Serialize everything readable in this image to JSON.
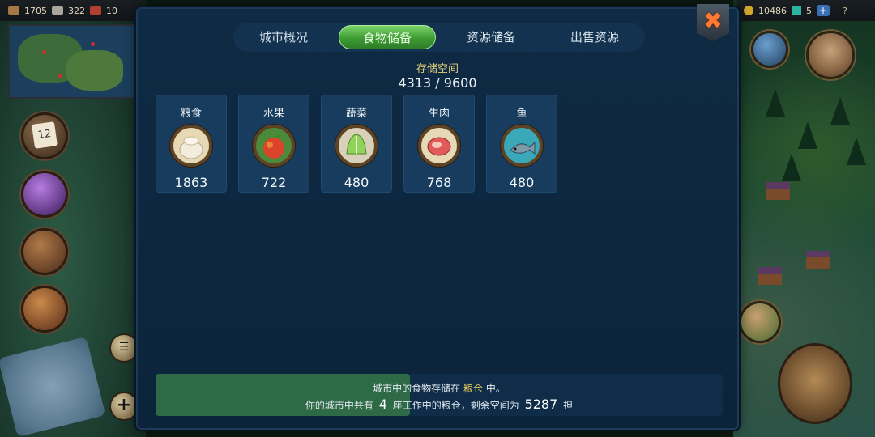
{
  "top_bar_left": {
    "res1": "1705",
    "res2": "322",
    "res3": "10"
  },
  "top_bar_right": {
    "gold": "10486",
    "gems": "5",
    "plus": "+",
    "help": "?"
  },
  "calendar_day": "12",
  "plus_button": "+",
  "tabs": [
    {
      "label": "城市概况",
      "active": false
    },
    {
      "label": "食物储备",
      "active": true
    },
    {
      "label": "资源储备",
      "active": false
    },
    {
      "label": "出售资源",
      "active": false
    }
  ],
  "close_label": "✖",
  "storage": {
    "label": "存储空间",
    "used": 4313,
    "capacity": 9600,
    "display": "4313 / 9600"
  },
  "foods": [
    {
      "name": "粮食",
      "value": "1863",
      "icon": "grain-sack-icon"
    },
    {
      "name": "水果",
      "value": "722",
      "icon": "apple-icon"
    },
    {
      "name": "蔬菜",
      "value": "480",
      "icon": "cabbage-icon"
    },
    {
      "name": "生肉",
      "value": "768",
      "icon": "meat-icon"
    },
    {
      "name": "鱼",
      "value": "480",
      "icon": "fish-icon"
    }
  ],
  "info": {
    "line1_prefix": "城市中的食物存储在",
    "line1_building": "粮仓",
    "line1_suffix": "中。",
    "line2_prefix": "你的城市中共有",
    "granary_count": "4",
    "line2_middle": "座工作中的粮仓，剩余空间为",
    "remaining": "5287",
    "line2_unit": "担",
    "fill_fraction": 0.449
  },
  "colors": {
    "accent_green": "#3f9b33",
    "panel_bg": "#0f2a44",
    "highlight_yellow": "#e8cf5a"
  }
}
